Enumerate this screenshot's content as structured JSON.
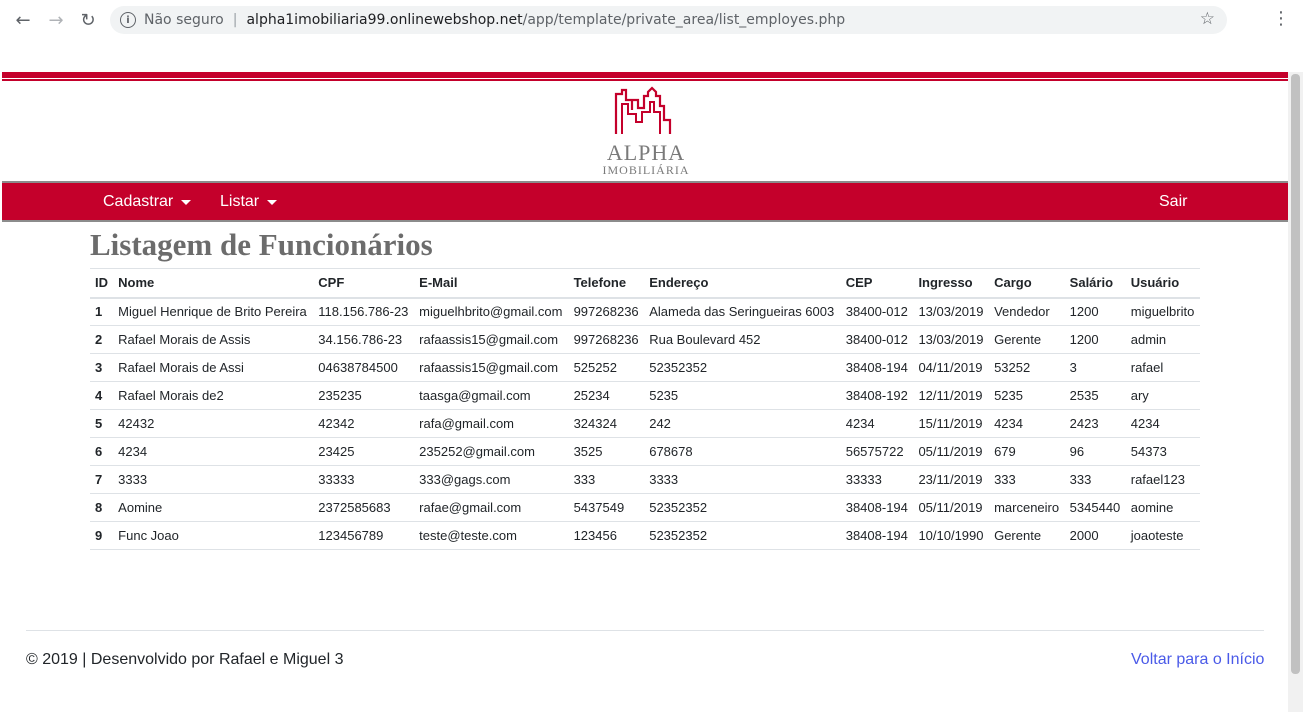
{
  "browser": {
    "back_icon": "←",
    "forward_icon": "→",
    "reload_icon": "↻",
    "info_icon": "i",
    "insecure_label": "Não seguro",
    "separator": "|",
    "url_host": "alpha1imobiliaria99.onlinewebshop.net",
    "url_path": "/app/template/private_area/list_employes.php",
    "star_icon": "☆",
    "menu_icon": "⋮"
  },
  "brand": {
    "logo_title": "ALPHA",
    "logo_subtitle": "IMOBILIÁRIA",
    "accent_color": "#c4002b"
  },
  "navbar": {
    "cadastrar": "Cadastrar",
    "listar": "Listar",
    "sair": "Sair"
  },
  "page": {
    "title": "Listagem de Funcionários"
  },
  "table": {
    "headers": [
      "ID",
      "Nome",
      "CPF",
      "E-Mail",
      "Telefone",
      "Endereço",
      "CEP",
      "Ingresso",
      "Cargo",
      "Salário",
      "Usuário"
    ],
    "rows": [
      [
        "1",
        "Miguel Henrique de Brito Pereira",
        "118.156.786-23",
        "miguelhbrito@gmail.com",
        "997268236",
        "Alameda das Seringueiras 6003",
        "38400-012",
        "13/03/2019",
        "Vendedor",
        "1200",
        "miguelbrito"
      ],
      [
        "2",
        "Rafael Morais de Assis",
        "34.156.786-23",
        "rafaassis15@gmail.com",
        "997268236",
        "Rua Boulevard 452",
        "38400-012",
        "13/03/2019",
        "Gerente",
        "1200",
        "admin"
      ],
      [
        "3",
        "Rafael Morais de Assi",
        "04638784500",
        "rafaassis15@gmail.com",
        "525252",
        "52352352",
        "38408-194",
        "04/11/2019",
        "53252",
        "3",
        "rafael"
      ],
      [
        "4",
        "Rafael Morais de2",
        "235235",
        "taasga@gmail.com",
        "25234",
        "5235",
        "38408-192",
        "12/11/2019",
        "5235",
        "2535",
        "ary"
      ],
      [
        "5",
        "42432",
        "42342",
        "rafa@gmail.com",
        "324324",
        "242",
        "4234",
        "15/11/2019",
        "4234",
        "2423",
        "4234"
      ],
      [
        "6",
        "4234",
        "23425",
        "235252@gmail.com",
        "3525",
        "678678",
        "56575722",
        "05/11/2019",
        "679",
        "96",
        "54373"
      ],
      [
        "7",
        "3333",
        "33333",
        "333@gags.com",
        "333",
        "3333",
        "33333",
        "23/11/2019",
        "333",
        "333",
        "rafael123"
      ],
      [
        "8",
        "Aomine",
        "2372585683",
        "rafae@gmail.com",
        "5437549",
        "52352352",
        "38408-194",
        "05/11/2019",
        "marceneiro",
        "5345440",
        "aomine"
      ],
      [
        "9",
        "Func Joao",
        "123456789",
        "teste@teste.com",
        "123456",
        "52352352",
        "38408-194",
        "10/10/1990",
        "Gerente",
        "2000",
        "joaoteste"
      ]
    ]
  },
  "footer": {
    "text": "© 2019 | Desenvolvido por Rafael e Miguel 3",
    "link": "Voltar para o Início"
  }
}
